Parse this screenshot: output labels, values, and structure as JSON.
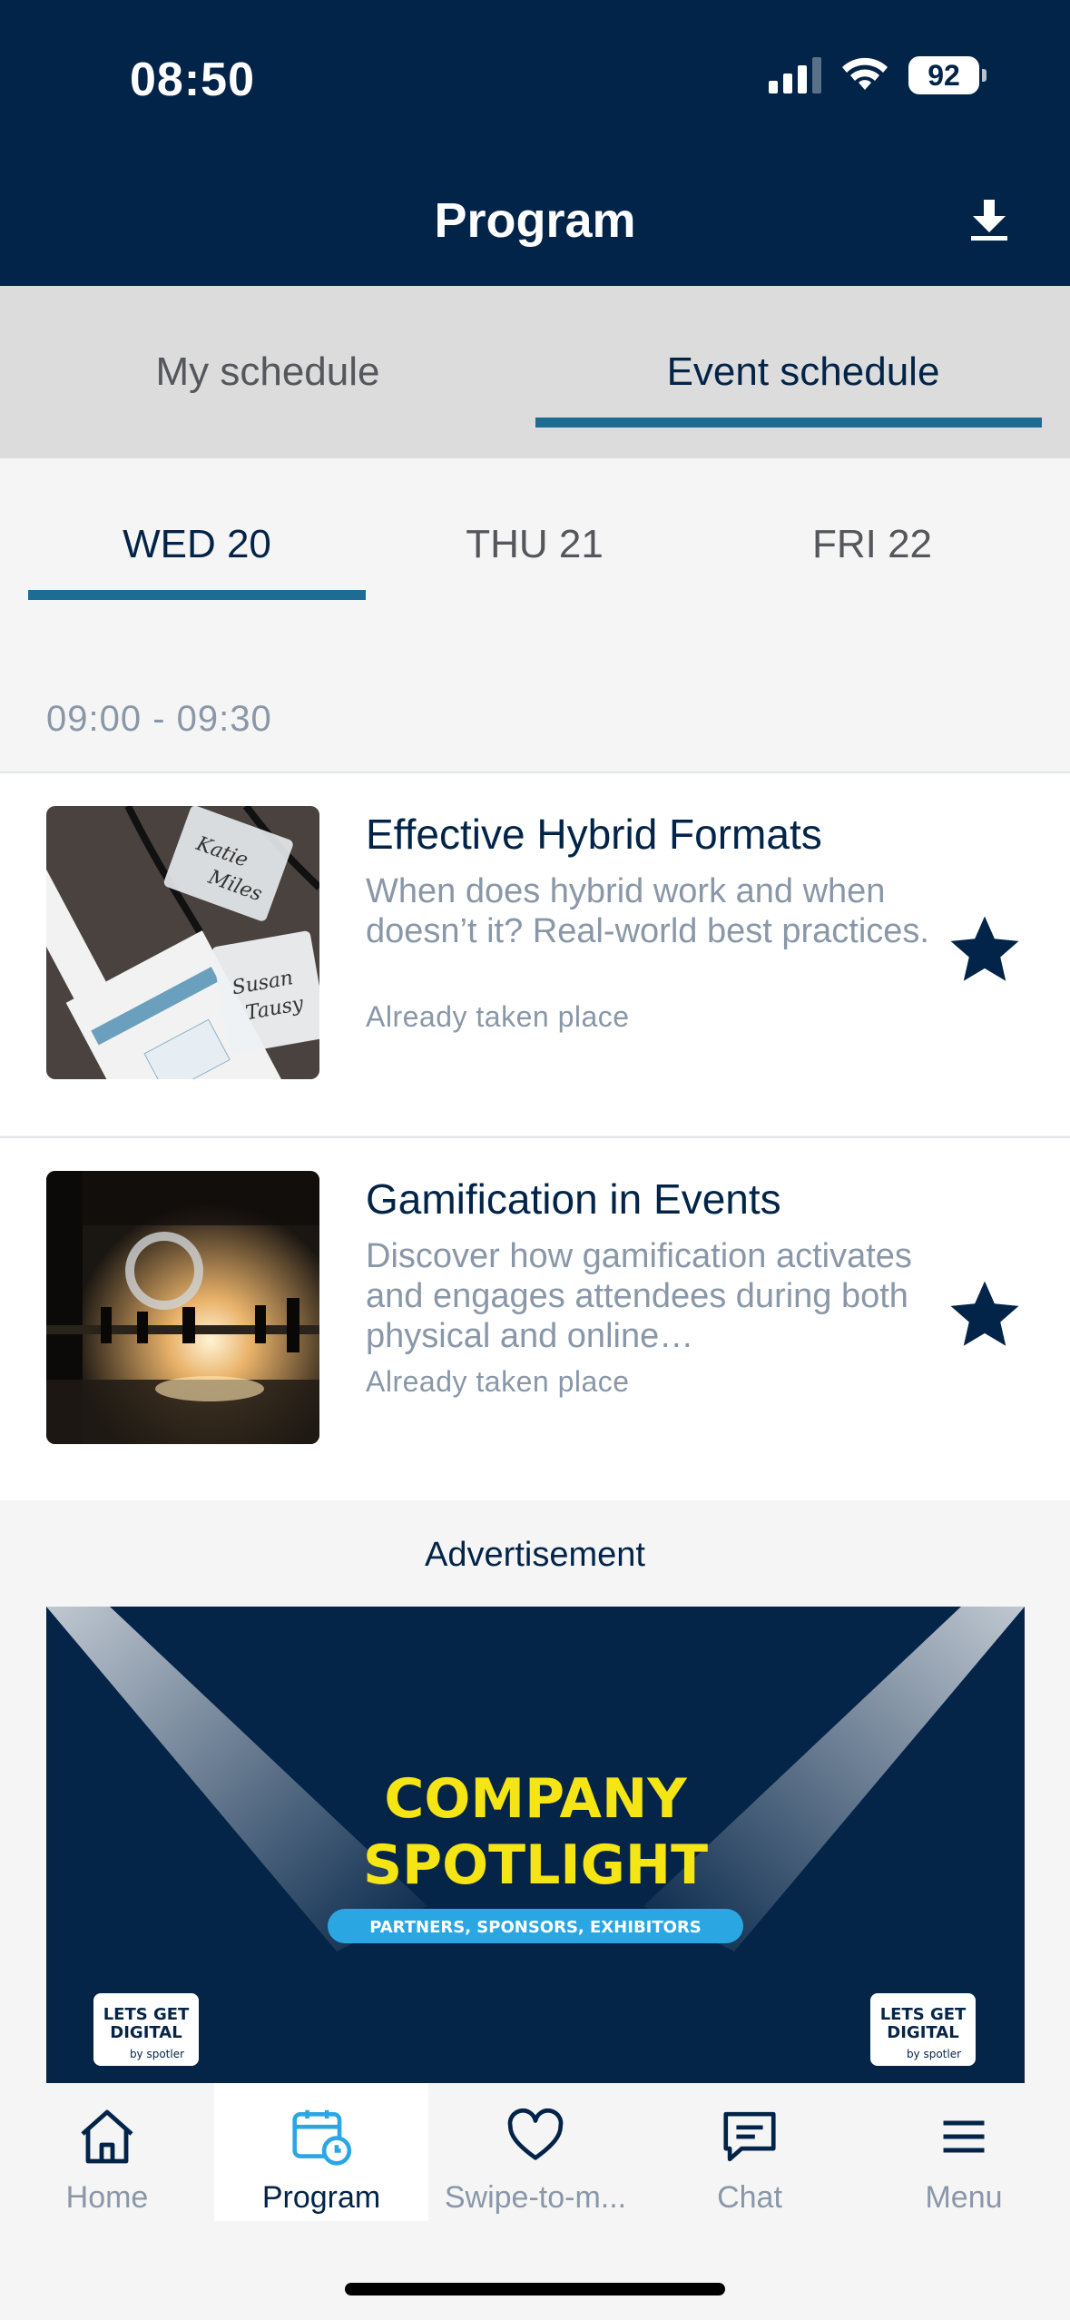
{
  "status_bar": {
    "time": "08:50",
    "battery": "92"
  },
  "header": {
    "title": "Program"
  },
  "schedule_tabs": [
    {
      "label": "My schedule",
      "active": false
    },
    {
      "label": "Event schedule",
      "active": true
    }
  ],
  "day_tabs": [
    {
      "label": "WED 20",
      "active": true
    },
    {
      "label": "THU 21",
      "active": false
    },
    {
      "label": "FRI 22",
      "active": false
    }
  ],
  "time_slot": "09:00 - 09:30",
  "sessions": [
    {
      "title": "Effective Hybrid Formats",
      "description": "When does hybrid work and when doesn’t it? Real-world best practices.",
      "status": "Already taken place",
      "starred": true
    },
    {
      "title": "Gamification in Events",
      "description": "Discover how gamification activates and engages attendees during both physical and online…",
      "status": "Already taken place",
      "starred": true
    }
  ],
  "ad": {
    "label": "Advertisement",
    "headline_1": "COMPANY",
    "headline_2": "SPOTLIGHT",
    "pill": "PARTNERS, SPONSORS, EXHIBITORS",
    "logo_line1": "LETS GET",
    "logo_line2": "DIGITAL",
    "logo_by": "by spotler"
  },
  "bottom_nav": [
    {
      "label": "Home",
      "icon": "home-icon",
      "active": false
    },
    {
      "label": "Program",
      "icon": "calendar-clock-icon",
      "active": true
    },
    {
      "label": "Swipe-to-m...",
      "icon": "heart-icon",
      "active": false
    },
    {
      "label": "Chat",
      "icon": "chat-icon",
      "active": false
    },
    {
      "label": "Menu",
      "icon": "menu-icon",
      "active": false
    }
  ],
  "colors": {
    "primary": "#022448",
    "accent": "#1c6c94",
    "muted": "#8a97a8",
    "ad_yellow": "#f6e514",
    "ad_pill": "#2aa7e3"
  }
}
